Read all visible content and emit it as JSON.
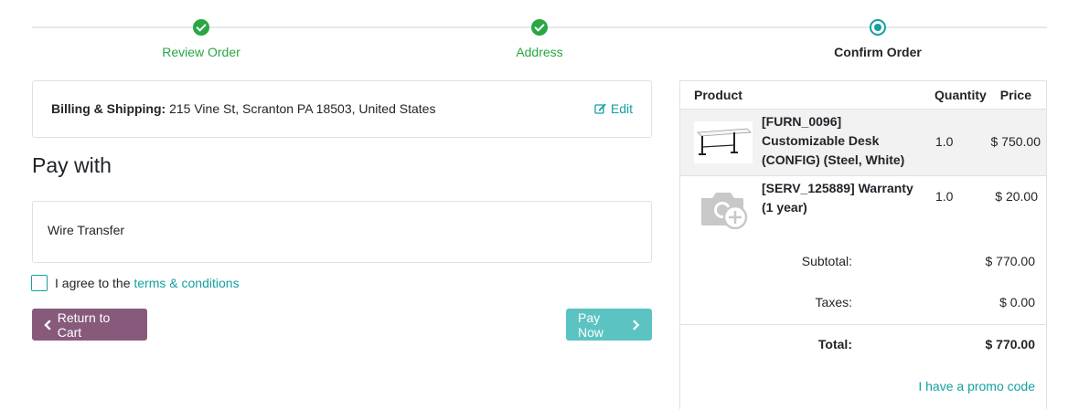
{
  "wizard": {
    "steps": [
      {
        "label": "Review Order",
        "state": "done"
      },
      {
        "label": "Address",
        "state": "done"
      },
      {
        "label": "Confirm Order",
        "state": "current"
      }
    ]
  },
  "address": {
    "label": "Billing & Shipping:",
    "value": "215 Vine St, Scranton PA 18503, United States",
    "edit_label": "Edit",
    "edit_icon": "edit-icon"
  },
  "payment": {
    "title": "Pay with",
    "method": "Wire Transfer",
    "agree_text": "I agree to the",
    "terms_link": "terms & conditions",
    "agree_checked": false,
    "return_label": "Return to Cart",
    "pay_label": "Pay Now"
  },
  "summary": {
    "headers": {
      "product": "Product",
      "quantity": "Quantity",
      "price": "Price"
    },
    "items": [
      {
        "name": "[FURN_0096] Customizable Desk (CONFIG) (Steel, White)",
        "quantity": "1.0",
        "price": "$ 750.00",
        "image": "desk-image"
      },
      {
        "name": "[SERV_125889] Warranty (1 year)",
        "quantity": "1.0",
        "price": "$ 20.00",
        "image": "camera-placeholder-icon"
      }
    ],
    "subtotal_label": "Subtotal:",
    "subtotal_value": "$ 770.00",
    "taxes_label": "Taxes:",
    "taxes_value": "$ 0.00",
    "total_label": "Total:",
    "total_value": "$ 770.00",
    "promo_label": "I have a promo code"
  },
  "colors": {
    "success": "#28a745",
    "primary": "#13a0a0",
    "return_button": "#875a7b",
    "pay_button": "#5cc3c3"
  }
}
